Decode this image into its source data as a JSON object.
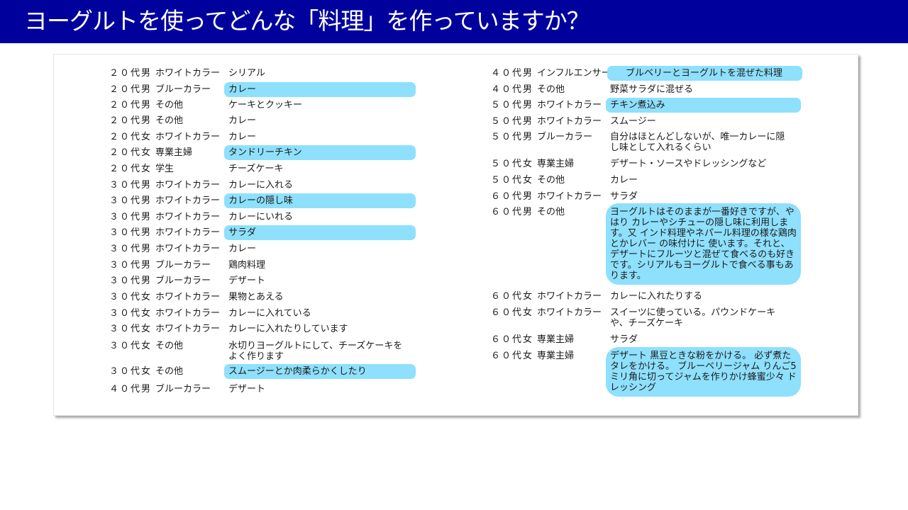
{
  "title": "ヨーグルトを使ってどんな「料理」を作っていますか？",
  "colors": {
    "header_bg": "#00009c",
    "highlight": "#8ee0fc"
  },
  "left_column": [
    {
      "age": "２０代男",
      "occupation": "ホワイトカラー",
      "answer": "シリアル",
      "highlighted": false
    },
    {
      "age": "２０代男",
      "occupation": "ブルーカラー",
      "answer": "カレー",
      "highlighted": true
    },
    {
      "age": "２０代男",
      "occupation": "その他",
      "answer": "ケーキとクッキー",
      "highlighted": false
    },
    {
      "age": "２０代男",
      "occupation": "その他",
      "answer": "カレー",
      "highlighted": false
    },
    {
      "age": "２０代女",
      "occupation": "ホワイトカラー",
      "answer": "カレー",
      "highlighted": false
    },
    {
      "age": "２０代女",
      "occupation": "専業主婦",
      "answer": "タンドリーチキン",
      "highlighted": true
    },
    {
      "age": "２０代女",
      "occupation": "学生",
      "answer": "チーズケーキ",
      "highlighted": false
    },
    {
      "age": "３０代男",
      "occupation": "ホワイトカラー",
      "answer": "カレーに入れる",
      "highlighted": false
    },
    {
      "age": "３０代男",
      "occupation": "ホワイトカラー",
      "answer": "カレーの隠し味",
      "highlighted": true
    },
    {
      "age": "３０代男",
      "occupation": "ホワイトカラー",
      "answer": "カレーにいれる",
      "highlighted": false
    },
    {
      "age": "３０代男",
      "occupation": "ホワイトカラー",
      "answer": "サラダ",
      "highlighted": true
    },
    {
      "age": "３０代男",
      "occupation": "ホワイトカラー",
      "answer": "カレー",
      "highlighted": false
    },
    {
      "age": "３０代男",
      "occupation": "ブルーカラー",
      "answer": "鶏肉料理",
      "highlighted": false
    },
    {
      "age": "３０代男",
      "occupation": "ブルーカラー",
      "answer": "デザート",
      "highlighted": false
    },
    {
      "age": "３０代女",
      "occupation": "ホワイトカラー",
      "answer": "果物とあえる",
      "highlighted": false
    },
    {
      "age": "３０代女",
      "occupation": "ホワイトカラー",
      "answer": "カレーに入れている",
      "highlighted": false
    },
    {
      "age": "３０代女",
      "occupation": "ホワイトカラー",
      "answer": "カレーに入れたりしています",
      "highlighted": false
    },
    {
      "age": "３０代女",
      "occupation": "その他",
      "answer": "水切りヨーグルトにして、チーズケーキをよく作ります",
      "highlighted": false
    },
    {
      "age": "３０代女",
      "occupation": "その他",
      "answer": "スムージーとか肉柔らかくしたり",
      "highlighted": true
    },
    {
      "age": "４０代男",
      "occupation": "ブルーカラー",
      "answer": "デザート",
      "highlighted": false
    }
  ],
  "right_column": [
    {
      "age": "４０代男",
      "occupation": "インフルエンサー",
      "answer": "ブルベリーとヨーグルトを混ぜた料理",
      "highlighted": true
    },
    {
      "age": "４０代男",
      "occupation": "その他",
      "answer": "野菜サラダに混ぜる",
      "highlighted": false
    },
    {
      "age": "５０代男",
      "occupation": "ホワイトカラー",
      "answer": "チキン煮込み",
      "highlighted": true
    },
    {
      "age": "５０代男",
      "occupation": "ホワイトカラー",
      "answer": "スムージー",
      "highlighted": false
    },
    {
      "age": "５０代男",
      "occupation": "ブルーカラー",
      "answer": "自分はほとんどしないが、唯一カレーに隠し味として入れるくらい",
      "highlighted": false
    },
    {
      "age": "５０代女",
      "occupation": "専業主婦",
      "answer": "デザート・ソースやドレッシングなど",
      "highlighted": false
    },
    {
      "age": "５０代女",
      "occupation": "その他",
      "answer": "カレー",
      "highlighted": false
    },
    {
      "age": "６０代男",
      "occupation": "ホワイトカラー",
      "answer": "サラダ",
      "highlighted": false
    },
    {
      "age": "６０代男",
      "occupation": "その他",
      "answer": "ヨーグルトはそのままが一番好きですが、やはり カレーやシチューの隠し味に利用します。又 インド料理やネパール料理の様な鶏肉とかレバー の味付けに 使います。それと、デザートにフルーツと混ぜて食べるのも好きです。シリアルもヨーグルトで食べる事もあります。",
      "highlighted": true
    },
    {
      "age": "６０代女",
      "occupation": "ホワイトカラー",
      "answer": "カレーに入れたりする",
      "highlighted": false
    },
    {
      "age": "６０代女",
      "occupation": "ホワイトカラー",
      "answer": "スイーツに使っている。パウンドケーキや、チーズケーキ",
      "highlighted": false
    },
    {
      "age": "６０代女",
      "occupation": "専業主婦",
      "answer": "サラダ",
      "highlighted": false
    },
    {
      "age": "６０代女",
      "occupation": "専業主婦",
      "answer": "デザート 黒豆ときな粉をかける。 必ず煮たタレをかける。 ブルーベリージャム りんご5ミリ角に切ってジャムを作りかけ蜂蜜少々 ドレッシング",
      "highlighted": true
    }
  ]
}
